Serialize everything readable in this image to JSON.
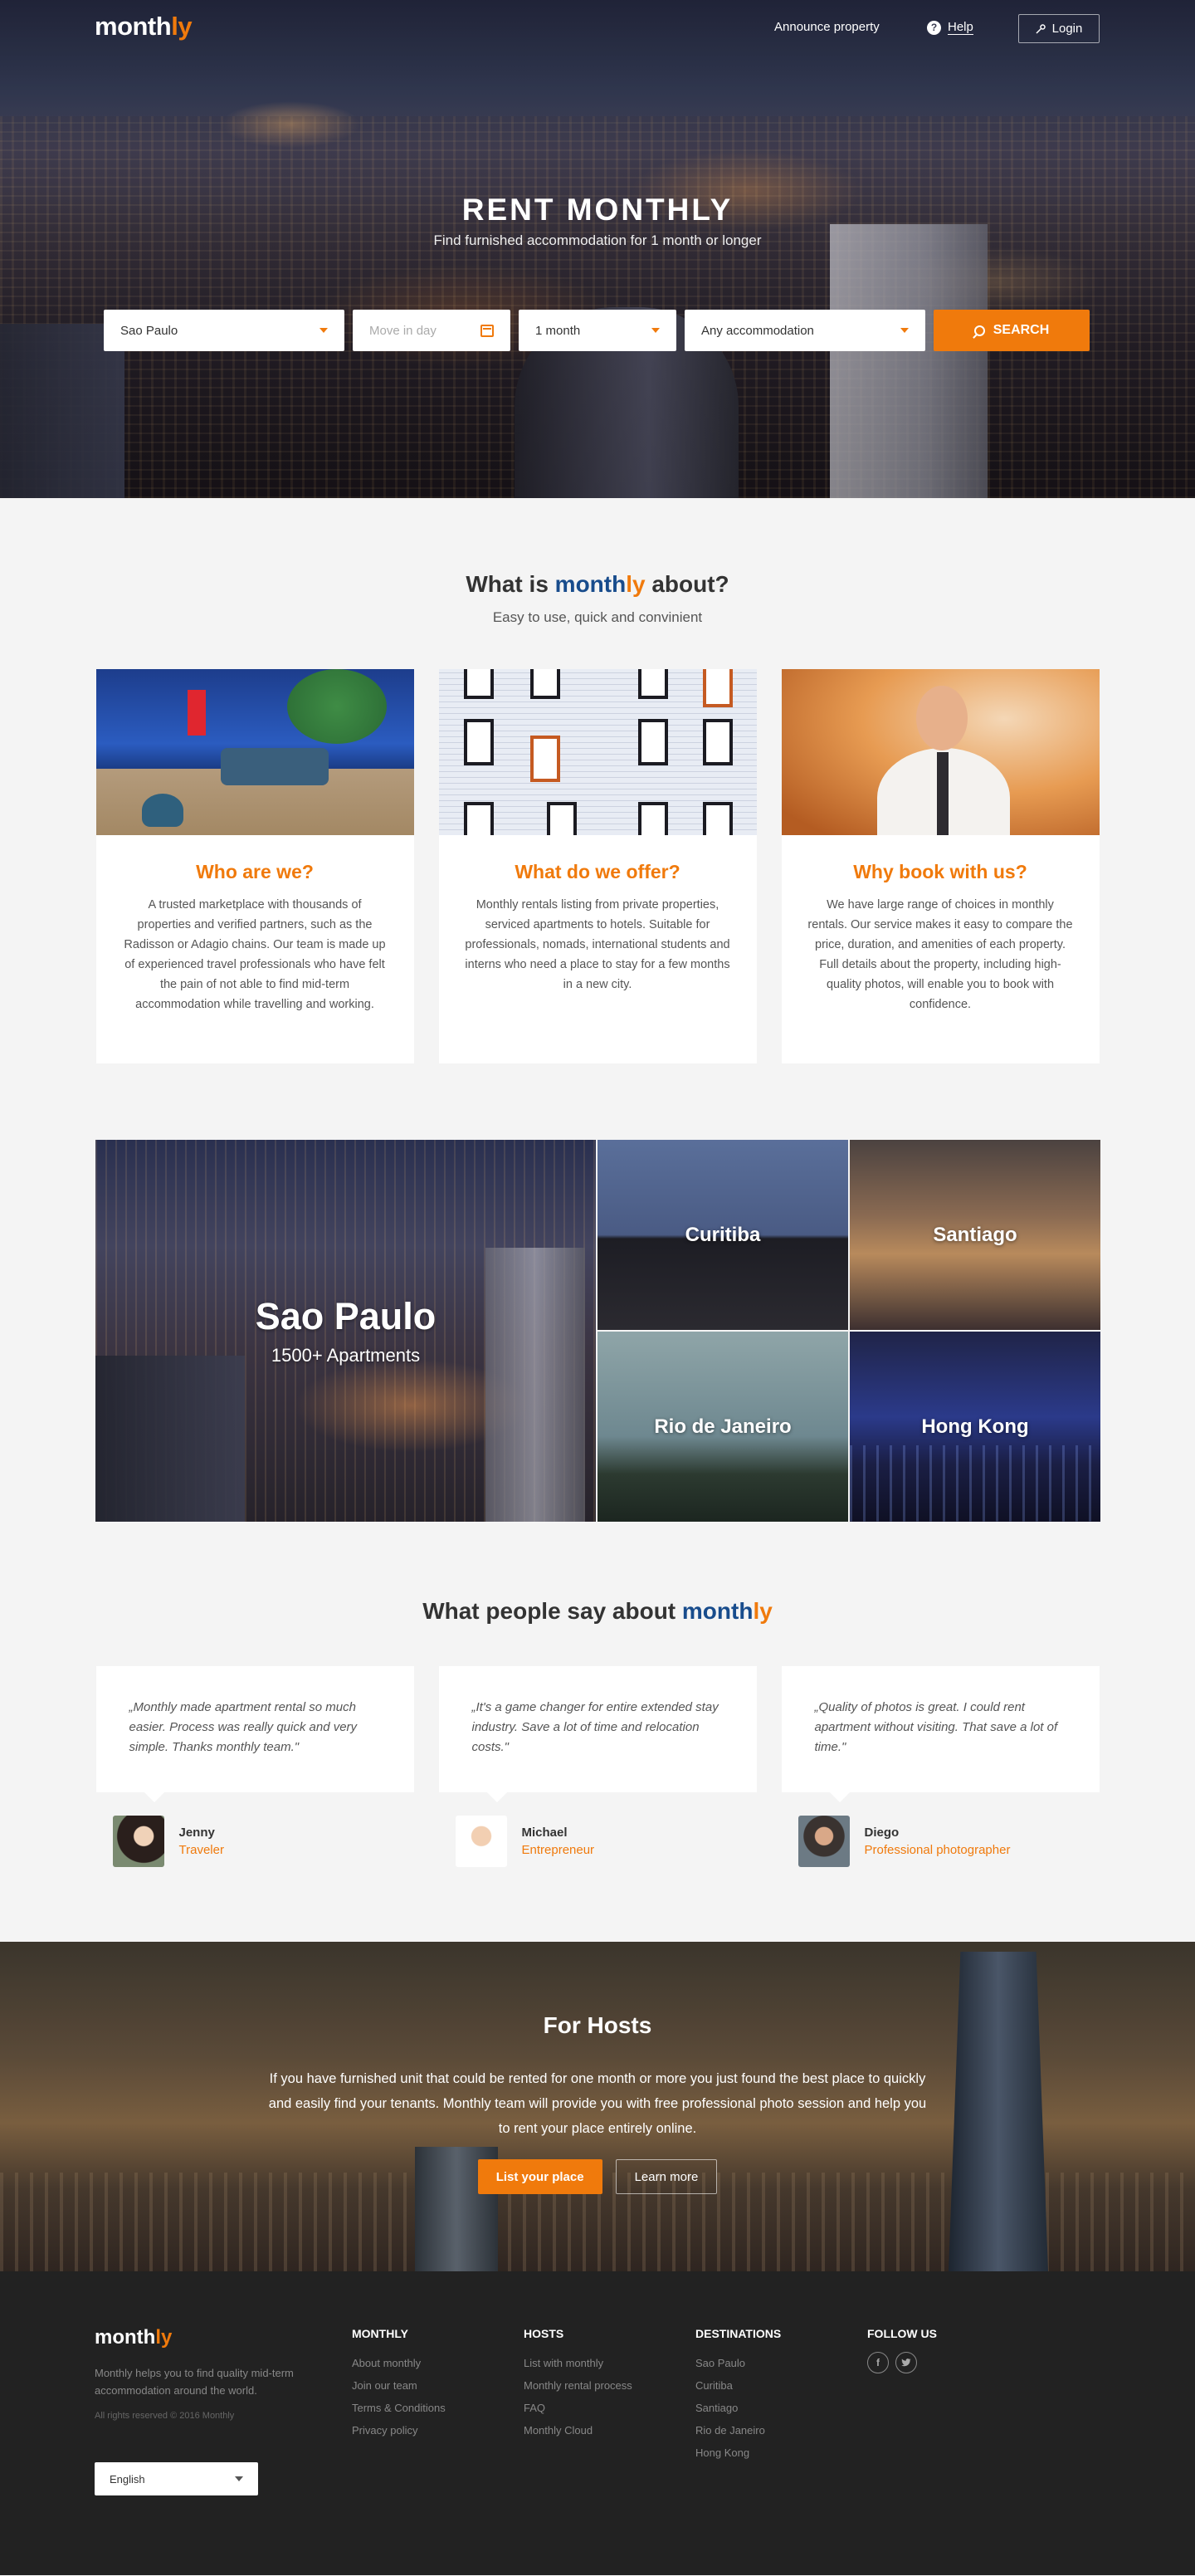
{
  "header": {
    "logo_main": "month",
    "logo_accent": "ly",
    "announce": "Announce property",
    "help": "Help",
    "login": "Login"
  },
  "hero": {
    "title": "RENT MONTHLY",
    "subtitle": "Find furnished accommodation for 1 month or longer",
    "search": {
      "city": "Sao Paulo",
      "move_in_placeholder": "Move in day",
      "duration": "1 month",
      "accommodation": "Any accommodation",
      "button": "SEARCH"
    }
  },
  "about": {
    "title_pre": "What is ",
    "title_brand_a": "month",
    "title_brand_b": "ly",
    "title_post": " about?",
    "subtitle": "Easy to use, quick and convinient",
    "cards": [
      {
        "title": "Who are we?",
        "text": "A trusted marketplace with thousands of properties and verified partners, such as the Radisson or Adagio chains. Our team is made up of experienced travel professionals who have felt the pain of not able to find mid-term accommodation while travelling and working."
      },
      {
        "title": "What do we offer?",
        "text": "Monthly rentals listing from private properties, serviced apartments to hotels. Suitable for professionals, nomads, international students and interns who need a place to stay for a few months in a new city."
      },
      {
        "title": "Why book with us?",
        "text": "We have large range of choices in monthly rentals. Our service makes it easy to compare the price, duration, and amenities of each property. Full details about the property, including high-quality photos, will enable you to book with confidence."
      }
    ]
  },
  "cities": {
    "featured": {
      "name": "Sao Paulo",
      "count": "1500+ Apartments"
    },
    "others": [
      "Curitiba",
      "Santiago",
      "Rio de Janeiro",
      "Hong Kong"
    ]
  },
  "testimonials": {
    "title_pre": "What people say about ",
    "title_brand_a": "month",
    "title_brand_b": "ly",
    "items": [
      {
        "quote": "„Monthly made apartment rental so much easier. Process was really quick and very simple. Thanks monthly team.\"",
        "name": "Jenny",
        "role": "Traveler"
      },
      {
        "quote": "„It's a game changer for entire extended stay industry. Save a lot of time and relocation costs.\"",
        "name": "Michael",
        "role": "Entrepreneur"
      },
      {
        "quote": "„Quality of photos is great. I could rent apartment without visiting. That save a lot of time.\"",
        "name": "Diego",
        "role": "Professional photographer"
      }
    ]
  },
  "hosts": {
    "title": "For Hosts",
    "text": "If you have furnished unit that could be rented for one month or more you just found the best place to quickly and easily find your tenants. Monthly team will provide you with free professional photo session and help you to rent your place entirely online.",
    "primary": "List your place",
    "secondary": "Learn more"
  },
  "footer": {
    "logo_main": "month",
    "logo_accent": "ly",
    "desc": "Monthly helps you to find quality mid-term accommodation around the world.",
    "copyright": "All rights reserved © 2016 Monthly",
    "language": "English",
    "columns": [
      {
        "title": "MONTHLY",
        "links": [
          "About monthly",
          "Join our team",
          "Terms & Conditions",
          "Privacy policy"
        ]
      },
      {
        "title": "HOSTS",
        "links": [
          "List with monthly",
          "Monthly rental process",
          "FAQ",
          "Monthly Cloud"
        ]
      },
      {
        "title": "DESTINATIONS",
        "links": [
          "Sao Paulo",
          "Curitiba",
          "Santiago",
          "Rio de Janeiro",
          "Hong Kong"
        ]
      }
    ],
    "follow": "FOLLOW US",
    "social_icons": [
      "facebook-icon",
      "twitter-icon"
    ]
  },
  "colors": {
    "accent": "#f07a0c",
    "brand_blue": "#184c8c",
    "footer_bg": "#222222"
  }
}
